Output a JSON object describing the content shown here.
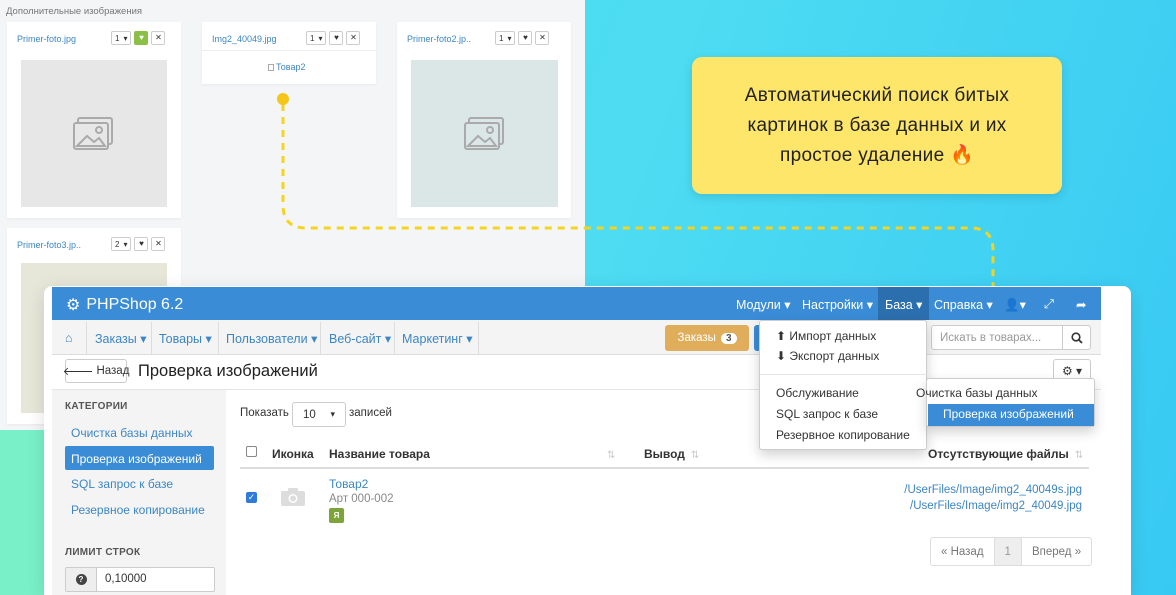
{
  "gallery": {
    "title": "Дополнительные изображения",
    "cards": [
      {
        "name": "Primer-foto.jpg",
        "order": "1"
      },
      {
        "name": "Img2_40049.jpg",
        "order": "1",
        "broken_alt": "Товар2"
      },
      {
        "name": "Primer-foto2.jp..",
        "order": "1"
      },
      {
        "name": "Primer-foto3.jp..",
        "order": "2"
      }
    ]
  },
  "callout": {
    "text": "Автоматический поиск битых картинок в базе данных и их простое удаление 🔥",
    "color": "#fde66a"
  },
  "app": {
    "brand": "PHPShop 6.2",
    "top_nav": [
      "Модули",
      "Настройки",
      "База",
      "Справка"
    ],
    "menu": [
      "Заказы",
      "Товары",
      "Пользователи",
      "Веб-сайт",
      "Маркетинг"
    ],
    "orders_button": {
      "label": "Заказы",
      "count": "3"
    },
    "search_placeholder": "Искать в товарах...",
    "back_label": "Назад",
    "page_title": "Проверка изображений",
    "accent": "#3a8cd6"
  },
  "db_menu": {
    "items": [
      "Импорт данных",
      "Экспорт данных",
      "Обслуживание",
      "SQL запрос к базе",
      "Резервное копирование"
    ]
  },
  "service_submenu": {
    "items": [
      "Очистка базы данных",
      "Проверка изображений"
    ],
    "active": "Проверка изображений"
  },
  "sidebar": {
    "categories_title": "КАТЕГОРИИ",
    "items": [
      "Очистка базы данных",
      "Проверка изображений",
      "SQL запрос к базе",
      "Резервное копирование"
    ],
    "active": "Проверка изображений",
    "limit_title": "ЛИМИТ СТРОК",
    "limit_value": "0,10000"
  },
  "table": {
    "show_label": "Показать",
    "page_size": "10",
    "records_label": "записей",
    "headers": [
      "Иконка",
      "Название товара",
      "Вывод",
      "Отсутствующие файлы"
    ],
    "rows": [
      {
        "checked": true,
        "name": "Товар2",
        "article": "Арт 000-002",
        "badge": "Я",
        "missing_files": [
          "/UserFiles/Image/img2_40049s.jpg",
          "/UserFiles/Image/img2_40049.jpg"
        ]
      }
    ]
  },
  "pager": {
    "prev": "« Назад",
    "current": "1",
    "next": "Вперед »"
  }
}
